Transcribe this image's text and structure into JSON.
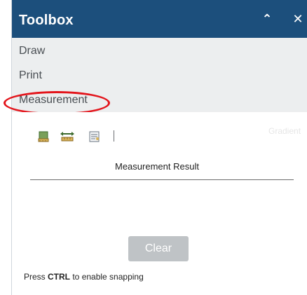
{
  "header": {
    "title": "Toolbox",
    "collapse_glyph": "⌃",
    "close_glyph": "✕"
  },
  "menu": {
    "items": [
      {
        "label": "Draw"
      },
      {
        "label": "Print"
      },
      {
        "label": "Measurement"
      }
    ]
  },
  "measurement": {
    "tools": [
      {
        "icon": "area-measure-icon"
      },
      {
        "icon": "distance-measure-icon"
      },
      {
        "icon": "location-measure-icon"
      }
    ],
    "units_label": "Gradient",
    "result_label": "Measurement Result",
    "clear_label": "Clear",
    "hint_prefix": "Press ",
    "hint_key": "CTRL",
    "hint_suffix": " to enable snapping"
  },
  "colors": {
    "header_bg": "#1c4f7c",
    "menu_bg": "#eceeef",
    "highlight": "#e3141b",
    "clear_button": "#bfc3c6"
  }
}
